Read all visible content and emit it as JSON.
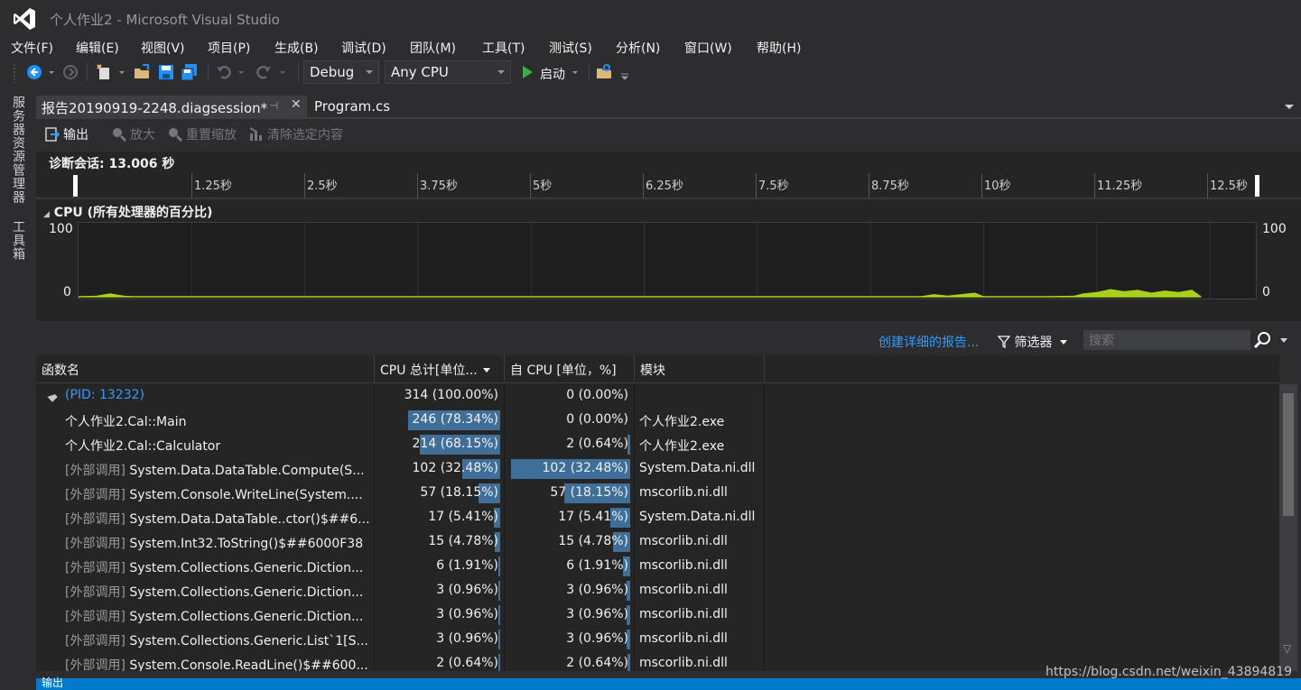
{
  "window": {
    "title": "个人作业2 - Microsoft Visual Studio"
  },
  "menu": [
    "文件(F)",
    "编辑(E)",
    "视图(V)",
    "项目(P)",
    "生成(B)",
    "调试(D)",
    "团队(M)",
    "工具(T)",
    "测试(S)",
    "分析(N)",
    "窗口(W)",
    "帮助(H)"
  ],
  "toolbar": {
    "config": "Debug",
    "platform": "Any CPU",
    "start_label": "启动"
  },
  "side_tabs": [
    "服务器资源管理器",
    "工具箱"
  ],
  "doc_tabs": {
    "active": "报告20190919-2248.diagsession*",
    "other": "Program.cs"
  },
  "diag_toolbar": {
    "output": "输出",
    "zoom_in": "放大",
    "reset_zoom": "重置缩放",
    "clear_selection": "清除选定内容"
  },
  "session": {
    "label": "诊断会话: 13.006 秒"
  },
  "ruler": {
    "ticks": [
      "1.25秒",
      "2.5秒",
      "3.75秒",
      "5秒",
      "6.25秒",
      "7.5秒",
      "8.75秒",
      "10秒",
      "11.25秒",
      "12.5秒"
    ]
  },
  "cpu_chart": {
    "title": "CPU (所有处理器的百分比)",
    "y_max_label": "100",
    "y_min_label": "0",
    "line_color": "#a8d11c"
  },
  "chart_data": {
    "type": "area",
    "title": "CPU (所有处理器的百分比)",
    "x_unit": "秒",
    "xlim": [
      0,
      13.006
    ],
    "ylim": [
      0,
      100
    ],
    "x": [
      0,
      0.2,
      0.35,
      0.5,
      0.6,
      0.8,
      8.0,
      9.3,
      9.45,
      9.6,
      9.75,
      9.9,
      10.0,
      10.4,
      10.7,
      11.0,
      11.1,
      11.25,
      11.4,
      11.55,
      11.7,
      11.85,
      12.0,
      12.15,
      12.3,
      12.4
    ],
    "y": [
      0,
      1,
      4,
      1,
      0,
      0,
      0,
      0,
      3,
      1,
      3,
      5,
      0,
      0,
      0,
      1,
      4,
      6,
      10,
      7,
      9,
      5,
      8,
      6,
      9,
      0
    ]
  },
  "actions": {
    "create_report": "创建详细的报告...",
    "filter": "筛选器",
    "search_placeholder": "搜索"
  },
  "table": {
    "columns": [
      "函数名",
      "CPU 总计[单位...",
      "自 CPU [单位，%]",
      "模块"
    ],
    "rows": [
      {
        "prefix": "",
        "name": "(PID: 13232)",
        "total": "314 (100.00%)",
        "total_pct": 100.0,
        "self": "0 (0.00%)",
        "self_pct": 0.0,
        "module": "",
        "pid": true
      },
      {
        "prefix": "",
        "name": "个人作业2.Cal::Main",
        "total": "246 (78.34%)",
        "total_pct": 78.34,
        "self": "0 (0.00%)",
        "self_pct": 0.0,
        "module": "个人作业2.exe"
      },
      {
        "prefix": "",
        "name": "个人作业2.Cal::Calculator",
        "total": "214 (68.15%)",
        "total_pct": 68.15,
        "self": "2 (0.64%)",
        "self_pct": 0.64,
        "module": "个人作业2.exe"
      },
      {
        "prefix": "[外部调用]",
        "name": "System.Data.DataTable.Compute(S...",
        "total": "102 (32.48%)",
        "total_pct": 32.48,
        "self": "102 (32.48%)",
        "self_pct": 32.48,
        "module": "System.Data.ni.dll"
      },
      {
        "prefix": "[外部调用]",
        "name": "System.Console.WriteLine(System....",
        "total": "57 (18.15%)",
        "total_pct": 18.15,
        "self": "57 (18.15%)",
        "self_pct": 18.15,
        "module": "mscorlib.ni.dll"
      },
      {
        "prefix": "[外部调用]",
        "name": "System.Data.DataTable..ctor()$##6...",
        "total": "17 (5.41%)",
        "total_pct": 5.41,
        "self": "17 (5.41%)",
        "self_pct": 5.41,
        "module": "System.Data.ni.dll"
      },
      {
        "prefix": "[外部调用]",
        "name": "System.Int32.ToString()$##6000F38",
        "total": "15 (4.78%)",
        "total_pct": 4.78,
        "self": "15 (4.78%)",
        "self_pct": 4.78,
        "module": "mscorlib.ni.dll"
      },
      {
        "prefix": "[外部调用]",
        "name": "System.Collections.Generic.Diction...",
        "total": "6 (1.91%)",
        "total_pct": 1.91,
        "self": "6 (1.91%)",
        "self_pct": 1.91,
        "module": "mscorlib.ni.dll"
      },
      {
        "prefix": "[外部调用]",
        "name": "System.Collections.Generic.Diction...",
        "total": "3 (0.96%)",
        "total_pct": 0.96,
        "self": "3 (0.96%)",
        "self_pct": 0.96,
        "module": "mscorlib.ni.dll"
      },
      {
        "prefix": "[外部调用]",
        "name": "System.Collections.Generic.Diction...",
        "total": "3 (0.96%)",
        "total_pct": 0.96,
        "self": "3 (0.96%)",
        "self_pct": 0.96,
        "module": "mscorlib.ni.dll"
      },
      {
        "prefix": "[外部调用]",
        "name": "System.Collections.Generic.List`1[S...",
        "total": "3 (0.96%)",
        "total_pct": 0.96,
        "self": "3 (0.96%)",
        "self_pct": 0.96,
        "module": "mscorlib.ni.dll"
      },
      {
        "prefix": "[外部调用]",
        "name": "System.Console.ReadLine()$##600...",
        "total": "2 (0.64%)",
        "total_pct": 0.64,
        "self": "2 (0.64%)",
        "self_pct": 0.64,
        "module": "mscorlib.ni.dll"
      }
    ]
  },
  "bottom": {
    "panel_label": "输出"
  },
  "watermark": "https://blog.csdn.net/weixin_43894819",
  "colors": {
    "bar": "#3f6f99",
    "link": "#3399ff",
    "status": "#007acc",
    "cpu_line": "#a8d11c"
  }
}
